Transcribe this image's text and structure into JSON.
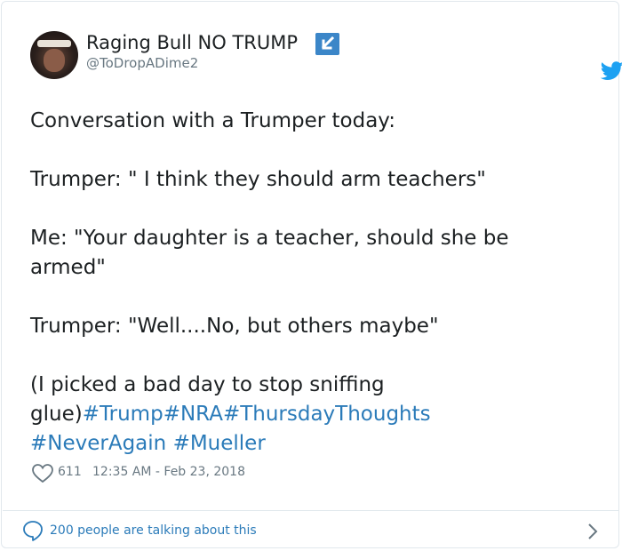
{
  "user": {
    "display_name": "Raging Bull NO TRUMP",
    "handle": "@ToDropADime2",
    "badge_icon": "arrow-down-left-icon"
  },
  "tweet": {
    "segments": [
      {
        "text": "Conversation with a Trumper today:\n\nTrumper: \" I think they should arm teachers\"\n\nMe: \"Your daughter is a teacher, should she be\narmed\"\n\nTrumper: \"Well....No, but others maybe\"\n\n(I picked a bad day to stop sniffing\nglue)",
        "type": "text"
      },
      {
        "text": "#Trump",
        "type": "hashtag"
      },
      {
        "text": "#NRA",
        "type": "hashtag"
      },
      {
        "text": "#ThursdayThoughts",
        "type": "hashtag"
      },
      {
        "text": "\n",
        "type": "text"
      },
      {
        "text": "#NeverAgain",
        "type": "hashtag"
      },
      {
        "text": " ",
        "type": "text"
      },
      {
        "text": "#Mueller",
        "type": "hashtag"
      }
    ],
    "like_count": "611",
    "timestamp": "12:35 AM - Feb 23, 2018"
  },
  "footer": {
    "talking_label": "200 people are talking about this"
  },
  "colors": {
    "link": "#2b7bb9",
    "muted": "#697882",
    "twitter_blue": "#1da1f2",
    "badge": "#3b86c8"
  }
}
